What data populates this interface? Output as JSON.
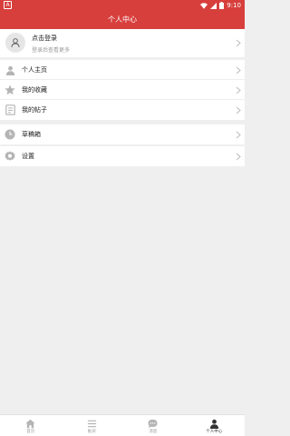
{
  "status_bar": {
    "time": "9:10",
    "left_badge": "A"
  },
  "header": {
    "title": "个人中心"
  },
  "login_card": {
    "title": "点击登录",
    "subtitle": "登录后查看更多",
    "avatar_icon": "user-icon"
  },
  "menu_group_1": [
    {
      "label": "个人主页",
      "icon": "person-icon"
    },
    {
      "label": "我的收藏",
      "icon": "star-icon"
    },
    {
      "label": "我的帖子",
      "icon": "document-icon"
    }
  ],
  "menu_group_2": [
    {
      "label": "草稿箱",
      "icon": "clock-icon"
    }
  ],
  "menu_group_3": [
    {
      "label": "设置",
      "icon": "gear-icon"
    }
  ],
  "tab_bar": [
    {
      "label": "首页",
      "icon": "home-icon",
      "active": false
    },
    {
      "label": "板块",
      "icon": "list-icon",
      "active": false
    },
    {
      "label": "消息",
      "icon": "message-icon",
      "active": false
    },
    {
      "label": "个人中心",
      "icon": "person-icon",
      "active": true
    }
  ],
  "colors": {
    "primary": "#d73f3d",
    "background": "#efefef",
    "icon_gray": "#b4b4b4"
  }
}
